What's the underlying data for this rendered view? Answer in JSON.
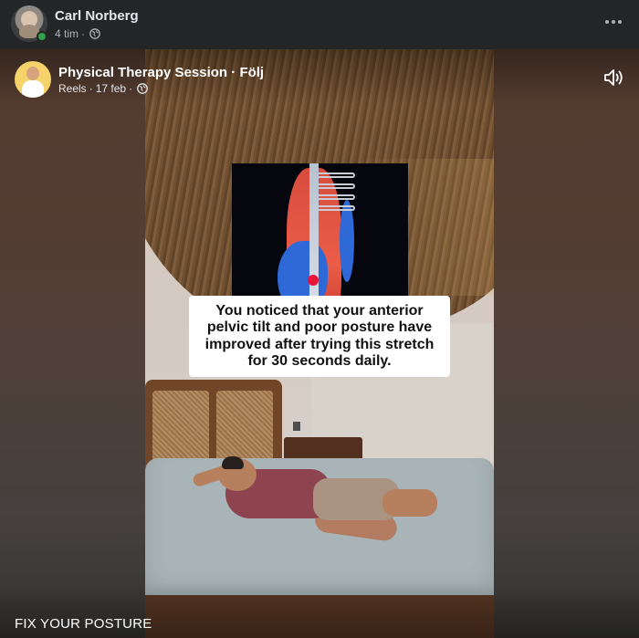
{
  "post": {
    "author": "Carl Norberg",
    "time": "4 tim",
    "separator": "·",
    "privacy_icon": "globe-icon",
    "more_icon": "more-options-icon"
  },
  "reel": {
    "page_name": "Physical Therapy Session",
    "follow_separator": " · ",
    "follow_label": "Följ",
    "source": "Reels",
    "date": "17 feb",
    "separator": "·",
    "privacy_icon": "globe-icon",
    "sound_icon": "speaker-icon",
    "caption": "You noticed that your anterior pelvic tilt and poor posture have improved after trying this stretch for 30 seconds daily.",
    "title": "FIX YOUR POSTURE"
  },
  "colors": {
    "background": "#242526",
    "online": "#31a24c",
    "text_primary": "#e4e6eb",
    "text_secondary": "#b0b3b8"
  }
}
